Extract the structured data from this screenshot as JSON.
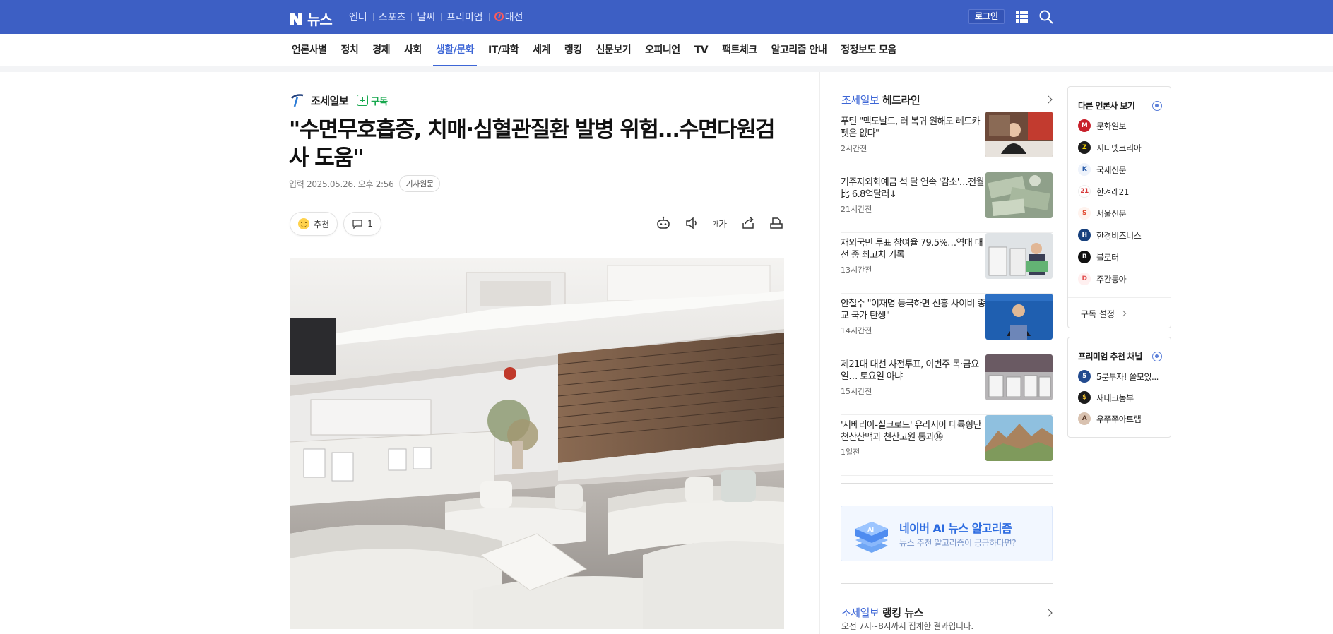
{
  "header": {
    "logo_text": "뉴스",
    "nav": [
      "엔터",
      "스포츠",
      "날씨",
      "프리미엄",
      "대선"
    ],
    "login_label": "로그인"
  },
  "sections": [
    "언론사별",
    "정치",
    "경제",
    "사회",
    "생활/문화",
    "IT/과학",
    "세계",
    "랭킹",
    "신문보기",
    "오피니언",
    "TV",
    "팩트체크",
    "알고리즘 안내",
    "정정보도 모음"
  ],
  "active_section": "생활/문화",
  "article": {
    "press_name": "조세일보",
    "subscribe_label": "구독",
    "headline": "\"수면무호흡증, 치매·심혈관질환 발병 위험…수면다원검사 도움\"",
    "date": "입력 2025.05.26. 오후 2:56",
    "original_label": "기사원문",
    "like_label": "추천",
    "comment_count": "1",
    "font_tool_label": "가"
  },
  "headline_box": {
    "press": "조세일보",
    "title": "헤드라인",
    "items": [
      {
        "title": "푸틴 \"맥도날드, 러 복귀 원해도 레드카펫은 없다\"",
        "time": "2시간전"
      },
      {
        "title": "거주자외화예금 석 달 연속 '감소'…전월比 6.8억달러↓",
        "time": "21시간전"
      },
      {
        "title": "재외국민 투표 참여율 79.5%…역대 대선 중 최고치 기록",
        "time": "13시간전"
      },
      {
        "title": "안철수 \"이재명 등극하면 신흥 사이비 종교 국가 탄생\"",
        "time": "14시간전"
      },
      {
        "title": "제21대 대선 사전투표, 이번주 목·금요일… 토요일 아냐",
        "time": "15시간전"
      },
      {
        "title": "'시베리아-실크로드' 유라시아 대륙횡단 천산산맥과 천산고원 통과㊱",
        "time": "1일전"
      }
    ]
  },
  "ai_box": {
    "badge": "AI",
    "title": "네이버 AI 뉴스 알고리즘",
    "subtitle": "뉴스 추천 알고리즘이 궁금하다면?"
  },
  "ranking": {
    "press": "조세일보",
    "title": "랭킹 뉴스",
    "subtitle": "오전 7시~8시까지 집계한 결과입니다."
  },
  "other_press": {
    "title": "다른 언론사 보기",
    "items": [
      "문화일보",
      "지디넷코리아",
      "국제신문",
      "한겨레21",
      "서울신문",
      "한경비즈니스",
      "블로터",
      "주간동아"
    ],
    "footer": "구독 설정"
  },
  "premium": {
    "title": "프리미엄 추천 채널",
    "items": [
      "5분투자! 쓸모있...",
      "재테크농부",
      "우쭈쭈아트랩"
    ]
  }
}
